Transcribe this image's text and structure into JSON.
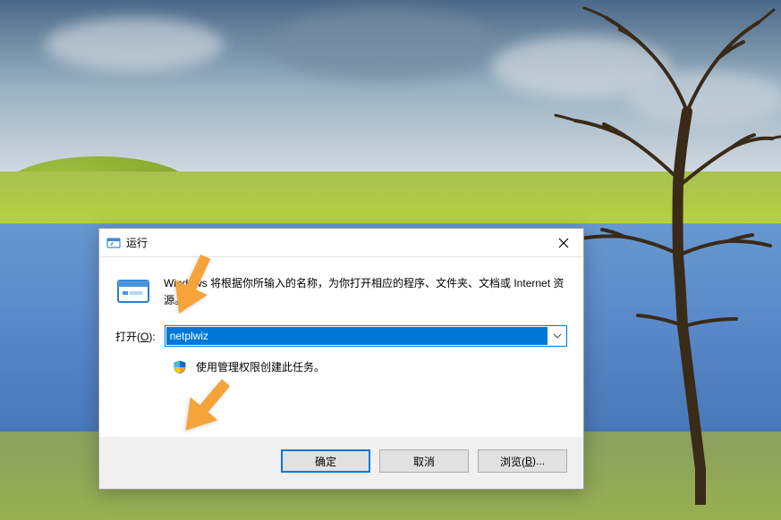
{
  "dialog": {
    "title": "运行",
    "description": "Windows 将根据你所输入的名称，为你打开相应的程序、文件夹、文档或 Internet 资源。",
    "open_label_prefix": "打开(",
    "open_label_accelerator": "O",
    "open_label_suffix": "):",
    "input_value": "netplwiz",
    "admin_text": "使用管理权限创建此任务。",
    "buttons": {
      "ok": "确定",
      "cancel": "取消",
      "browse_prefix": "浏览(",
      "browse_accelerator": "B",
      "browse_suffix": ")..."
    }
  }
}
